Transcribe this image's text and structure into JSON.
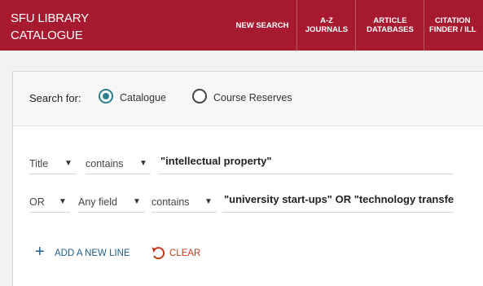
{
  "header": {
    "logo_line1": "SFU LIBRARY",
    "logo_line2": "CATALOGUE",
    "nav": [
      {
        "line1": "NEW SEARCH",
        "line2": ""
      },
      {
        "line1": "A-Z",
        "line2": "JOURNALS"
      },
      {
        "line1": "ARTICLE",
        "line2": "DATABASES"
      },
      {
        "line1": "CITATION",
        "line2": "FINDER / ILL"
      }
    ]
  },
  "search_for": {
    "label": "Search for:",
    "options": [
      {
        "label": "Catalogue",
        "selected": true
      },
      {
        "label": "Course Reserves",
        "selected": false
      }
    ]
  },
  "rows": [
    {
      "operator": "",
      "field": "Title",
      "match": "contains",
      "value": "\"intellectual property\""
    },
    {
      "operator": "OR",
      "field": "Any field",
      "match": "contains",
      "value": "\"university start-ups\" OR \"technology transfer\""
    }
  ],
  "actions": {
    "add_line": "ADD A NEW LINE",
    "clear": "CLEAR"
  },
  "colors": {
    "header_bg": "#a6192e",
    "radio_selected": "#2c7f8c",
    "link_blue": "#1f5e8f",
    "clear_red": "#c43a1b"
  },
  "icons": {
    "dropdown": "triangle-down-icon",
    "add": "plus-icon",
    "clear": "undo-arrow-icon"
  }
}
